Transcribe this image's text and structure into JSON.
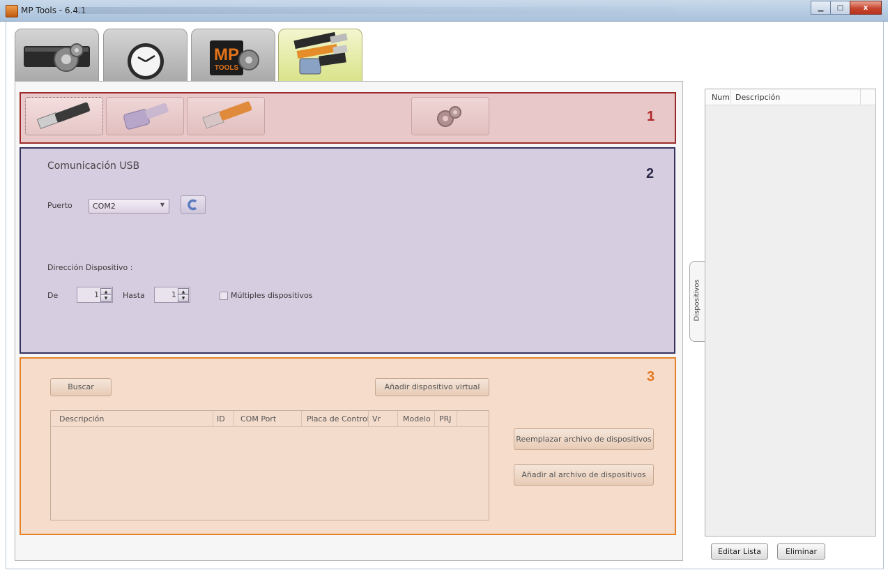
{
  "window": {
    "title": "MP Tools - 6.4.1",
    "minimize_glyph": "▁",
    "maximize_glyph": "□",
    "close_glyph": "x"
  },
  "tabs": [
    {
      "name": "settings-tab",
      "icon": "gear-card-icon"
    },
    {
      "name": "clock-tab",
      "icon": "clock-icon"
    },
    {
      "name": "mp-tools-tab",
      "icon": "mp-tools-logo-icon"
    },
    {
      "name": "communication-tab",
      "icon": "cables-icon",
      "active": true
    }
  ],
  "section1": {
    "number": "1",
    "buttons": [
      {
        "name": "usb-button",
        "icon": "usb-cable-icon",
        "selected": true
      },
      {
        "name": "serial-button",
        "icon": "serial-cable-icon"
      },
      {
        "name": "ethernet-button",
        "icon": "ethernet-cable-icon"
      },
      {
        "name": "config-button",
        "icon": "gears-icon"
      }
    ]
  },
  "section2": {
    "number": "2",
    "heading": "Comunicación USB",
    "port_label": "Puerto",
    "port_value": "COM2",
    "address_label": "Dirección Dispositivo :",
    "from_label": "De",
    "from_value": "1",
    "to_label": "Hasta",
    "to_value": "1",
    "multiple_label": "Múltiples dispositivos",
    "multiple_checked": false
  },
  "section3": {
    "number": "3",
    "search_button": "Buscar",
    "add_virtual_button": "Añadir dispositivo virtual",
    "replace_button": "Reemplazar archivo de dispositivos",
    "append_button": "Añadir al archivo de dispositivos",
    "table_headers": [
      "Descripción",
      "ID",
      "COM Port",
      "Placa de Control",
      "Vr",
      "Modelo",
      "PRJ"
    ],
    "rows": []
  },
  "devices_panel": {
    "tab_label": "Dispositivos",
    "headers": [
      "Num",
      "Descripción"
    ],
    "rows": [],
    "edit_button": "Editar Lista",
    "delete_button": "Eliminar"
  },
  "colors": {
    "section1_border": "#9d2a2a",
    "section2_border": "#36325e",
    "section3_border": "#e6822a",
    "section1_number": "#b02828",
    "section2_number": "#2e2a4a",
    "section3_number": "#e6771f"
  }
}
